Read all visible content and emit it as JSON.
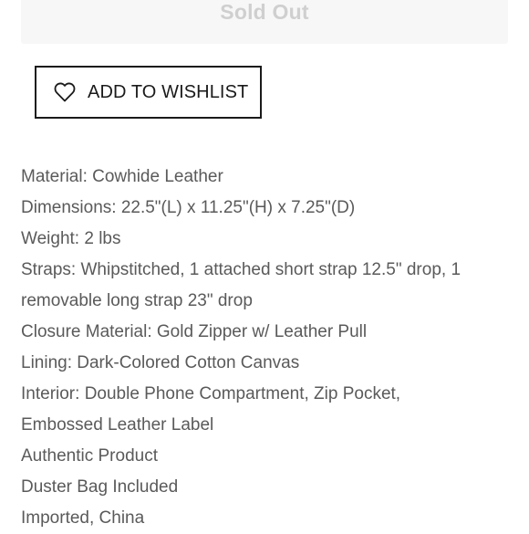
{
  "sold_out": {
    "label": "Sold Out"
  },
  "wishlist": {
    "icon": "heart-outline-icon",
    "label": "ADD TO WISHLIST"
  },
  "details": [
    "Material: Cowhide Leather",
    "Dimensions: 22.5\"(L) x 11.25\"(H) x 7.25\"(D)",
    "Weight: 2 lbs",
    "Straps: Whipstitched, 1 attached short strap 12.5\" drop, 1",
    "removable long strap 23\" drop",
    "Closure Material: Gold Zipper w/ Leather Pull",
    "Lining: Dark-Colored Cotton Canvas",
    "Interior: Double Phone Compartment, Zip Pocket,",
    "Embossed Leather Label",
    "Authentic Product",
    "Duster Bag Included",
    "Imported, China"
  ],
  "colors": {
    "sold_out_bg": "#f7f7f7",
    "sold_out_text": "#cfcfcf",
    "button_border": "#1a1a1a",
    "detail_text": "#5a5a5a"
  }
}
